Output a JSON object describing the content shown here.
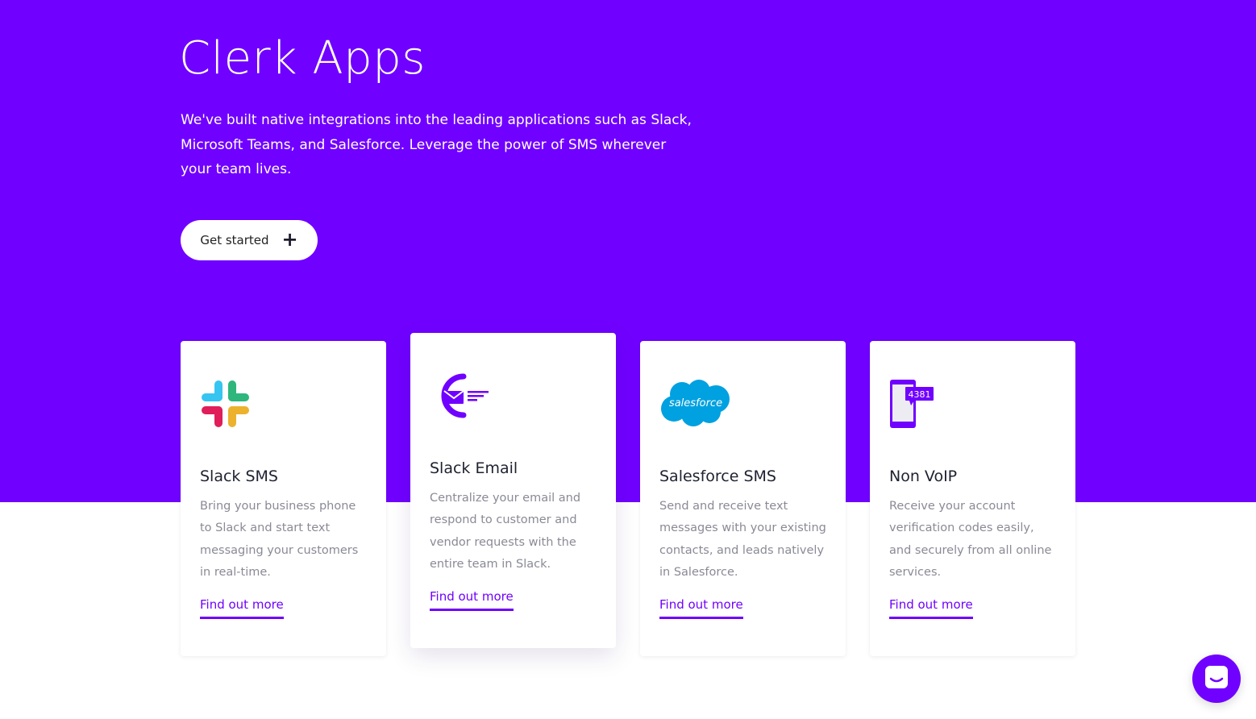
{
  "hero": {
    "title": "Clerk Apps",
    "description": "We've built native integrations into the leading applications such as Slack, Microsoft Teams, and Salesforce. Leverage the power of SMS wherever your team lives.",
    "cta_label": "Get started",
    "cta_icon": "plus-icon",
    "background_color": "#7000ff"
  },
  "cards": [
    {
      "title": "Slack SMS",
      "description": "Bring your business phone to Slack and start text messaging your customers in real-time.",
      "link_label": "Find out more",
      "icon": "slack-logo-icon"
    },
    {
      "title": "Slack Email",
      "description": "Centralize your email and respond to customer and vendor requests with the entire team in Slack.",
      "link_label": "Find out more",
      "icon": "clerk-email-logo-icon"
    },
    {
      "title": "Salesforce SMS",
      "description": "Send and receive text messages with your existing contacts, and leads natively in Salesforce.",
      "link_label": "Find out more",
      "icon": "salesforce-logo-icon",
      "logo_text": "salesforce"
    },
    {
      "title": "Non VoIP",
      "description": "Receive your account verification codes easily, and securely from all online services.",
      "link_label": "Find out more",
      "icon": "phone-code-icon",
      "logo_text": "4381"
    }
  ],
  "chat": {
    "icon": "chat-icon"
  },
  "colors": {
    "accent": "#7000ff",
    "link": "#7000ff",
    "body_text": "#8a8a96",
    "heading_text": "#1e2130"
  }
}
